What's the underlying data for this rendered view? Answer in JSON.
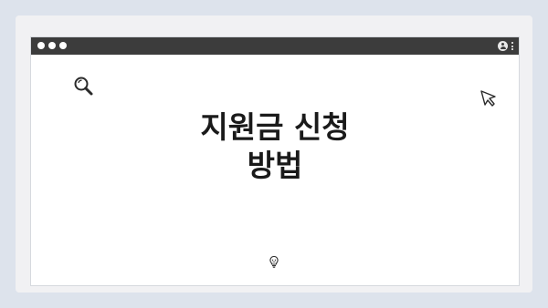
{
  "window": {
    "traffic_lights": [
      "close",
      "minimize",
      "maximize"
    ],
    "icons": [
      "user-icon",
      "kebab-menu-icon",
      "search-icon",
      "cursor-icon",
      "lightbulb-icon"
    ]
  },
  "main": {
    "title_line1": "지원금 신청",
    "title_line2": "방법"
  },
  "colors": {
    "background": "#dde3ec",
    "titlebar": "#3c3c3c",
    "window": "#ffffff",
    "text": "#1a1a1a"
  }
}
